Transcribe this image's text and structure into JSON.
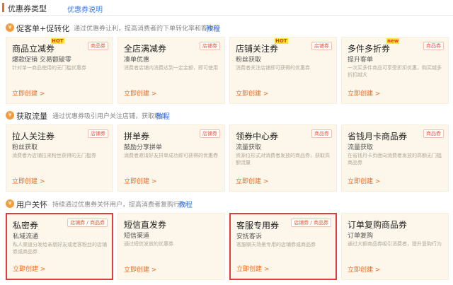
{
  "header": {
    "title": "优惠券类型",
    "help_link": "优惠券说明"
  },
  "sections": [
    {
      "name": "促客单+促转化",
      "desc": "通过优惠券让利，提高消费者的下单转化率和客单价",
      "link": "教程",
      "cards": [
        {
          "title": "商品立减券",
          "badge": "HOT",
          "tag": "商品券",
          "subtitle": "爆款促销 交易额破零",
          "desc": "针对单一商品使用的无门槛优惠券",
          "action": "立即创建 >"
        },
        {
          "title": "全店满减券",
          "badge": "",
          "tag": "店铺券",
          "subtitle": "凑单优惠",
          "desc": "消费者店铺内消费达到一定金额，即可使用",
          "action": "立即创建 >"
        },
        {
          "title": "店铺关注券",
          "badge": "HOT",
          "tag": "店铺券",
          "subtitle": "粉丝获取",
          "desc": "消费者关注店铺即可获得的优惠券",
          "action": "立即创建 >"
        },
        {
          "title": "多件多折券",
          "badge": "new",
          "tag": "商品券",
          "subtitle": "提升客单",
          "desc": "一次买多件商品可享受折扣优惠，购买越多折扣越大",
          "action": "立即创建 >"
        }
      ]
    },
    {
      "name": "获取流量",
      "desc": "通过优惠券吸引用户关注店铺，获取粉丝",
      "link": "教程",
      "cards": [
        {
          "title": "拉人关注券",
          "badge": "",
          "tag": "店铺券",
          "subtitle": "粉丝获取",
          "desc": "消费者为店铺拉来粉丝获得的无门槛券",
          "action": "立即创建 >"
        },
        {
          "title": "拼单券",
          "badge": "",
          "tag": "店铺券",
          "subtitle": "鼓励分享拼单",
          "desc": "消费者邀请好友拼单成功即可获得的优惠券",
          "action": "立即创建 >"
        },
        {
          "title": "领券中心券",
          "badge": "",
          "tag": "商品券",
          "subtitle": "流量获取",
          "desc": "资源位形式对消费者发放的商品券，获取高额流量",
          "action": "立即创建 >"
        },
        {
          "title": "省钱月卡商品券",
          "badge": "",
          "tag": "商品券",
          "subtitle": "流量获取",
          "desc": "在省钱月卡页面向消费者发放的高额无门槛商品券",
          "action": "立即创建 >"
        }
      ]
    },
    {
      "name": "用户关怀",
      "desc": "持续通过优惠券关怀用户，提高消费者复购行为",
      "link": "教程",
      "cards": [
        {
          "title": "私密券",
          "badge": "",
          "tag": "店铺券 / 商品券",
          "subtitle": "私域流通",
          "desc": "私人渠道分发给亲朋好友或老客粉丝的店铺券或商品券",
          "action": "立即创建 >",
          "highlight": true
        },
        {
          "title": "短信直发券",
          "badge": "",
          "tag": "",
          "subtitle": "短信渠道",
          "desc": "通过短信发放的优惠券",
          "action": "立即创建 >"
        },
        {
          "title": "客服专用券",
          "badge": "",
          "tag": "店铺券 / 商品券",
          "subtitle": "安抚客诉",
          "desc": "客服聊天场景专用的店铺券或商品券",
          "action": "立即创建 >",
          "highlight": true
        },
        {
          "title": "订单复购商品券",
          "badge": "",
          "tag": "",
          "subtitle": "订单复购",
          "desc": "通过大额商品券吸引消费者，提升复购行为",
          "action": "立即创建 >"
        }
      ]
    }
  ]
}
